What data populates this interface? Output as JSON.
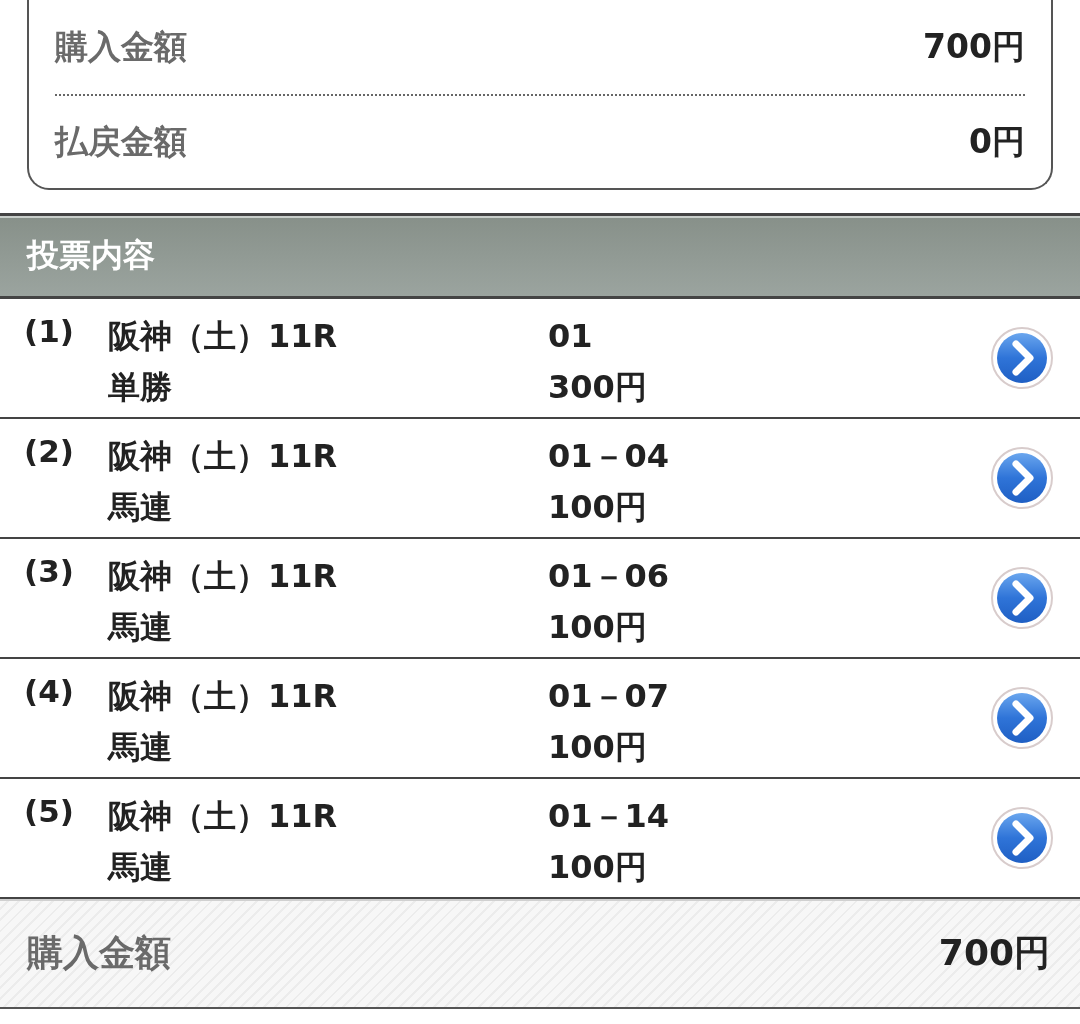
{
  "summary": [
    {
      "label": "購入金額",
      "value": "700円"
    },
    {
      "label": "払戻金額",
      "value": "0円"
    }
  ],
  "section_title": "投票内容",
  "bets": [
    {
      "index": "(1)",
      "race": "阪神（土）11R",
      "type": "単勝",
      "combination": "01",
      "amount": "300円"
    },
    {
      "index": "(2)",
      "race": "阪神（土）11R",
      "type": "馬連",
      "combination": "01－04",
      "amount": "100円"
    },
    {
      "index": "(3)",
      "race": "阪神（土）11R",
      "type": "馬連",
      "combination": "01－06",
      "amount": "100円"
    },
    {
      "index": "(4)",
      "race": "阪神（土）11R",
      "type": "馬連",
      "combination": "01－07",
      "amount": "100円"
    },
    {
      "index": "(5)",
      "race": "阪神（土）11R",
      "type": "馬連",
      "combination": "01－14",
      "amount": "100円"
    }
  ],
  "total": {
    "label": "購入金額",
    "value": "700円"
  }
}
